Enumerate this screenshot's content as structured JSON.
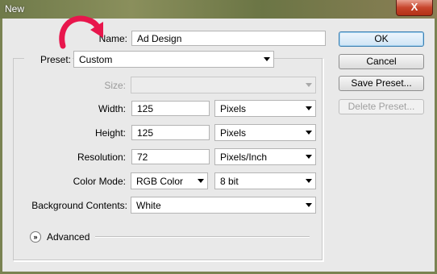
{
  "window": {
    "title": "New",
    "close_glyph": "X"
  },
  "form": {
    "name_label": "Name:",
    "name_value": "Ad Design",
    "preset_label": "Preset:",
    "preset_value": "Custom",
    "size_label": "Size:",
    "size_value": "",
    "width_label": "Width:",
    "width_value": "125",
    "width_unit": "Pixels",
    "height_label": "Height:",
    "height_value": "125",
    "height_unit": "Pixels",
    "resolution_label": "Resolution:",
    "resolution_value": "72",
    "resolution_unit": "Pixels/Inch",
    "color_mode_label": "Color Mode:",
    "color_mode_value": "RGB Color",
    "bit_depth_value": "8 bit",
    "background_label": "Background Contents:",
    "background_value": "White",
    "advanced_label": "Advanced",
    "advanced_icon": "double-chevron-down"
  },
  "buttons": {
    "ok": "OK",
    "cancel": "Cancel",
    "save_preset": "Save Preset...",
    "delete_preset": "Delete Preset..."
  },
  "colors": {
    "annotation_arrow": "#e8164c",
    "default_button_border": "#3c7fb1"
  }
}
